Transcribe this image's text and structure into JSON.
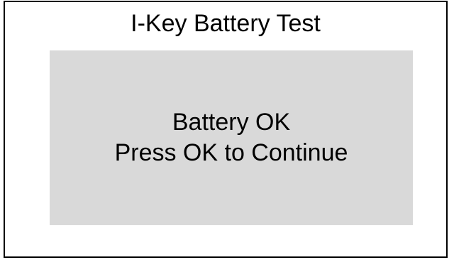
{
  "screen": {
    "title": "I-Key Battery Test",
    "message": {
      "status": "Battery OK",
      "instruction": "Press OK to Continue"
    }
  },
  "colors": {
    "background": "#ffffff",
    "border": "#000000",
    "panel": "#d9d9d9",
    "text": "#000000"
  }
}
